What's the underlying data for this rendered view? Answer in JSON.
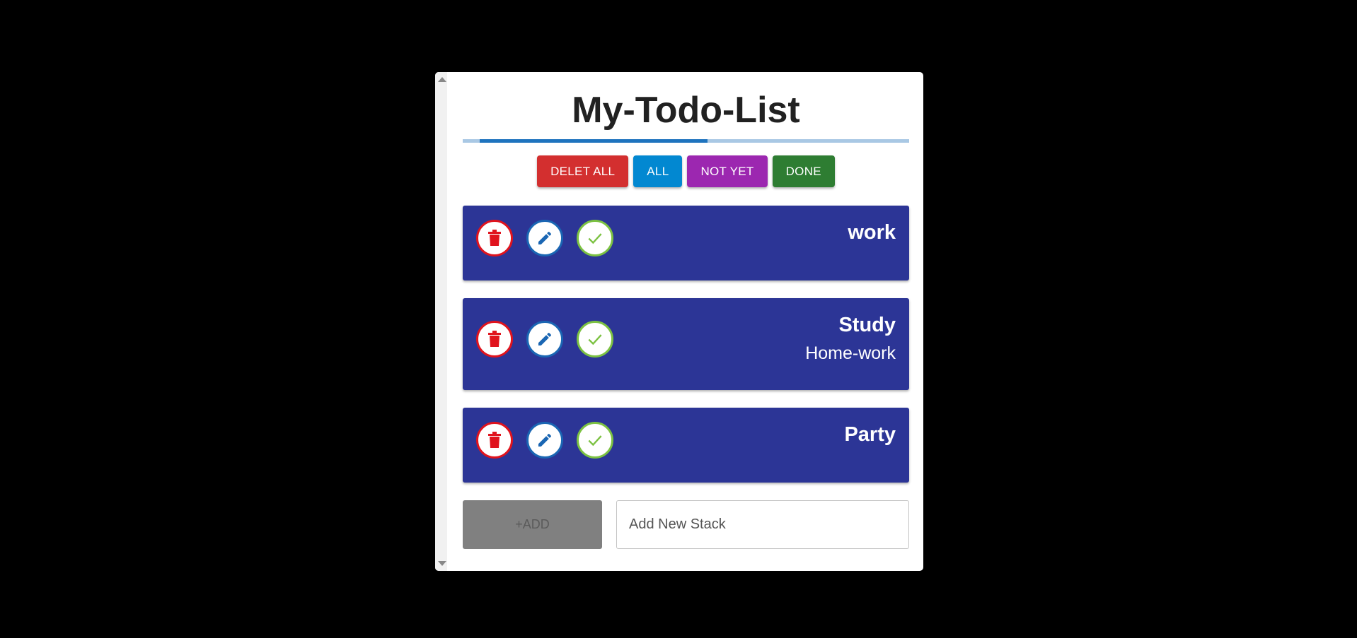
{
  "app": {
    "title": "My-Todo-List",
    "progress": 0.51
  },
  "filters": [
    {
      "label": "DELET ALL",
      "color": "#d32f2f"
    },
    {
      "label": "ALL",
      "color": "#0288d1"
    },
    {
      "label": "NOT YET",
      "color": "#9c27b0"
    },
    {
      "label": "DONE",
      "color": "#2e7d32"
    }
  ],
  "todos": [
    {
      "title": "work",
      "description": ""
    },
    {
      "title": "Study",
      "description": "Home-work"
    },
    {
      "title": "Party",
      "description": ""
    }
  ],
  "icons": {
    "delete": "trash-icon",
    "edit": "pencil-icon",
    "done": "check-icon"
  },
  "colors": {
    "card_bg": "#2c3596",
    "delete_accent": "#e0131d",
    "edit_accent": "#1a66b3",
    "done_accent": "#7cc242"
  },
  "composer": {
    "add_label": "+ADD",
    "placeholder": "Add New Stack",
    "value": ""
  }
}
